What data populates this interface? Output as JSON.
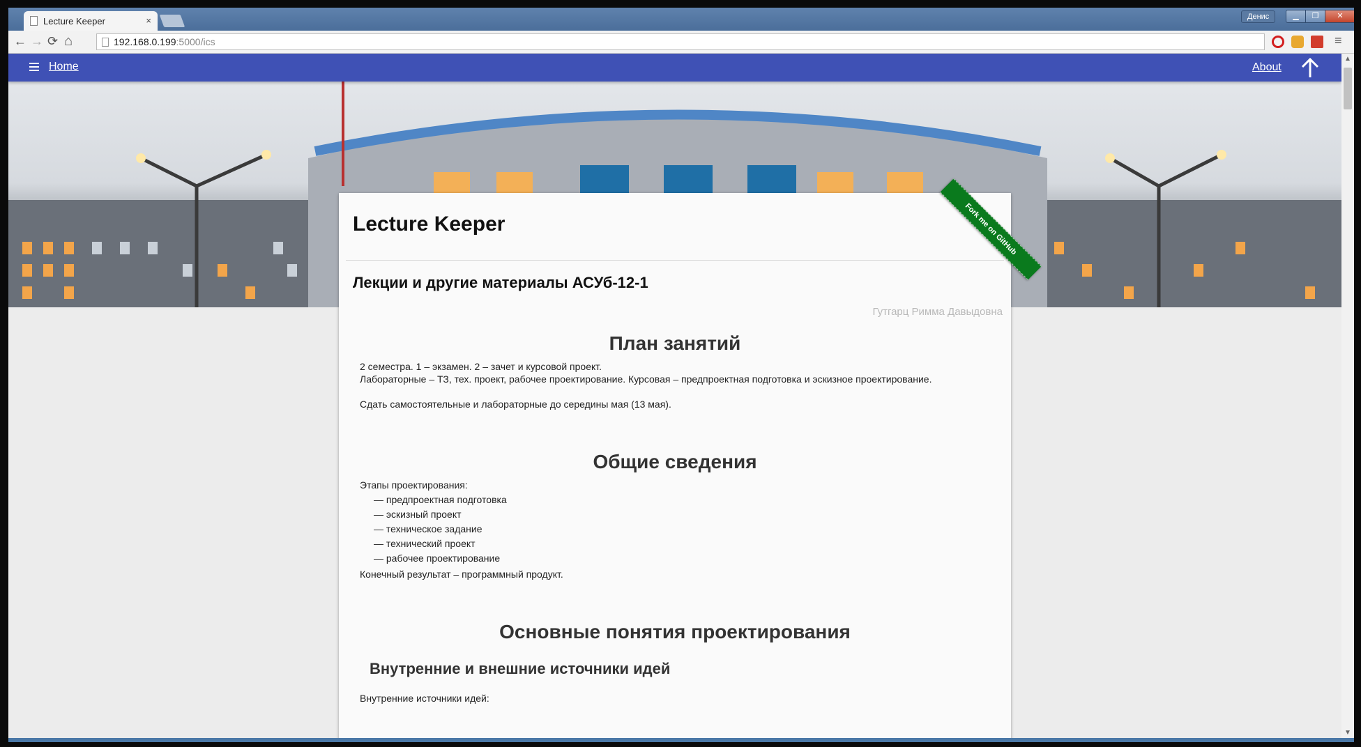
{
  "browser": {
    "tab_title": "Lecture Keeper",
    "tab_close": "×",
    "user_badge": "Денис",
    "url_host": "192.168.0.199",
    "url_path": ":5000/ics",
    "nav": {
      "back": "←",
      "forward": "→",
      "reload": "⟳",
      "home": "⌂",
      "menu": "≡"
    },
    "window": {
      "minimize": "▁",
      "maximize": "❐",
      "close": "✕"
    }
  },
  "appbar": {
    "home_label": "Home",
    "about_label": "About"
  },
  "ribbon": {
    "label": "Fork me on GitHub"
  },
  "page": {
    "title": "Lecture Keeper",
    "subtitle": "Лекции и другие материалы АСУб-12-1",
    "teacher": "Гутгарц Римма Давыдовна"
  },
  "sections": [
    {
      "heading": "План занятий",
      "paragraphs": [
        "2 семестра. 1 – экзамен. 2 – зачет и курсовой проект.",
        "Лабораторные – ТЗ, тех. проект, рабочее проектирование. Курсовая – предпроектная подготовка и эскизное проектирование.",
        "Сдать самостоятельные и лабораторные до середины мая (13 мая)."
      ]
    },
    {
      "heading": "Общие сведения",
      "intro": "Этапы проектирования:",
      "list": [
        "— предпроектная подготовка",
        "— эскизный проект",
        "— техническое задание",
        "— технический проект",
        "— рабочее проектирование"
      ],
      "outro": "Конечный результат – программный продукт."
    },
    {
      "heading": "Основные понятия проектирования",
      "subheading": "Внутренние и внешние источники идей",
      "text": "Внутренние источники идей:"
    }
  ],
  "colors": {
    "appbar": "#3f51b5",
    "ribbon": "#0a7a1d",
    "teacher_text": "#b8b8b8"
  }
}
